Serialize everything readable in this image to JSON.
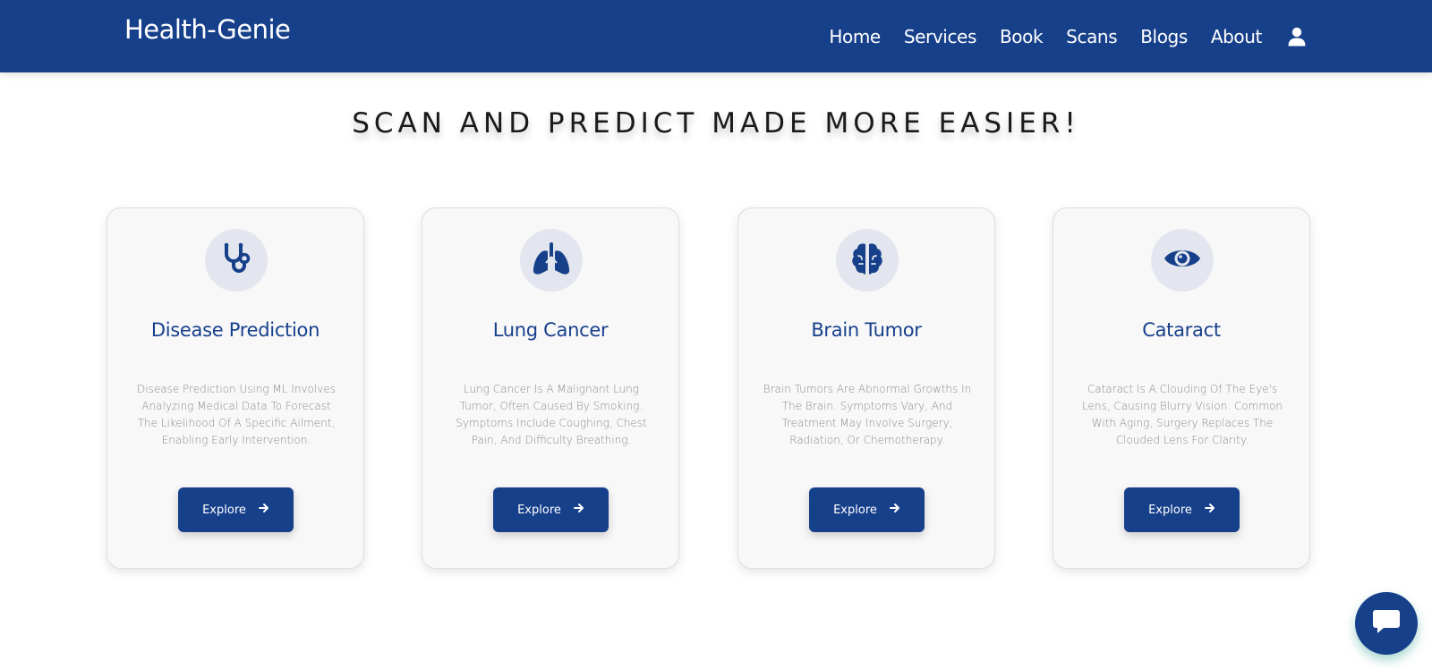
{
  "brand": "Health-Genie",
  "nav": [
    "Home",
    "Services",
    "Book",
    "Scans",
    "Blogs",
    "About"
  ],
  "nav_icons": {
    "user": "user-icon"
  },
  "heading": "SCAN AND PREDICT MADE MORE EASIER!",
  "cards": [
    {
      "icon": "stethoscope-icon",
      "title": "Disease Prediction",
      "description": "Disease Prediction Using ML Involves Analyzing Medical Data To Forecast The Likelihood Of A Specific Ailment, Enabling Early Intervention.",
      "button": "Explore"
    },
    {
      "icon": "lungs-icon",
      "title": "Lung Cancer",
      "description": "Lung Cancer Is A Malignant Lung Tumor, Often Caused By Smoking. Symptoms Include Coughing, Chest Pain, And Difficulty Breathing.",
      "button": "Explore"
    },
    {
      "icon": "brain-icon",
      "title": "Brain Tumor",
      "description": "Brain Tumors Are Abnormal Growths In The Brain. Symptoms Vary, And Treatment May Involve Surgery, Radiation, Or Chemotherapy.",
      "button": "Explore"
    },
    {
      "icon": "eye-icon",
      "title": "Cataract",
      "description": "Cataract Is A Clouding Of The Eye's Lens, Causing Blurry Vision. Common With Aging, Surgery Replaces The Clouded Lens For Clarity.",
      "button": "Explore"
    }
  ],
  "chat": {
    "icon": "chat-icon"
  },
  "colors": {
    "primary": "#17408b",
    "icon_bg": "#e3e6ee",
    "card_bg": "#f8f8f9",
    "text_muted": "#8a8a8a"
  }
}
